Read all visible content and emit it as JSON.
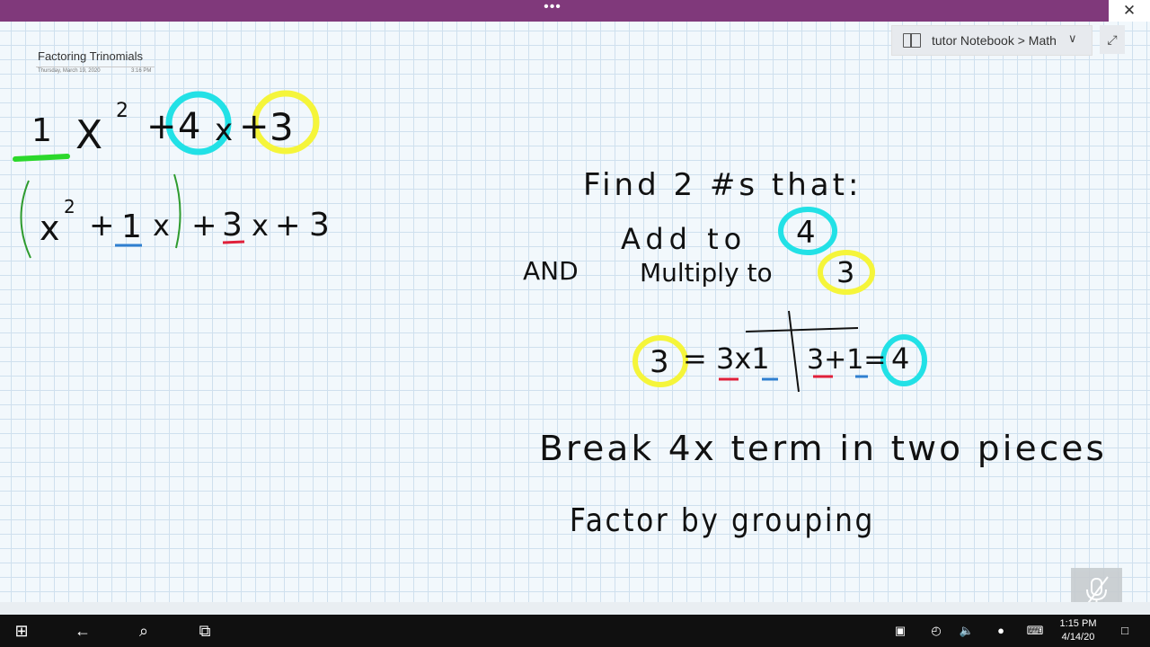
{
  "titlebar": {
    "menu_dots": "•••",
    "close": "✕"
  },
  "page": {
    "title": "Factoring Trinomials",
    "date": "Thursday, March 19, 2020",
    "time": "3:16 PM"
  },
  "notebook": {
    "breadcrumb": "tutor Notebook > Math"
  },
  "ink_notes": {
    "expression": [
      "1",
      "X",
      "2",
      "+",
      "4",
      "x",
      "+",
      "3"
    ],
    "rewrite": [
      "(",
      "x",
      "2",
      "+",
      "1",
      "x",
      ")",
      "+",
      "3",
      "x",
      "+",
      "3"
    ],
    "find": "Find 2 #s that:",
    "add": "Add to",
    "add_value": "4",
    "and": "AND",
    "multiply": "Multiply to",
    "multiply_value": "3",
    "product_lhs": "3",
    "product_rhs": "= 3x1",
    "sum": "3+1=",
    "sum_value": "4",
    "break": "Break 4x term in two pieces",
    "factor": "Factor by grouping"
  },
  "taskbar": {
    "start": "⊞",
    "back": "←",
    "search": "⌕",
    "taskview": "⧉",
    "time": "1:15 PM",
    "date": "4/14/20"
  },
  "colors": {
    "titlebar": "#80397b",
    "highlight_cyan": "#22e1e6",
    "highlight_yellow": "#f5f53a",
    "underline_green": "#2bd82b",
    "underline_blue": "#2f7fd0",
    "underline_red": "#e0203a"
  }
}
